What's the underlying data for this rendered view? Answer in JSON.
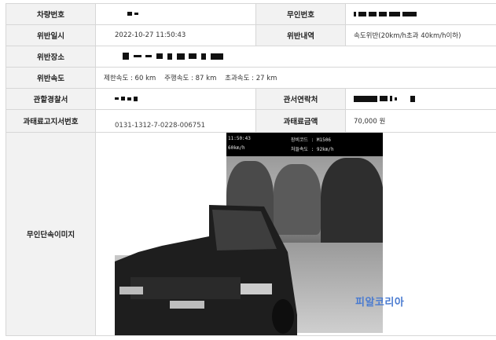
{
  "labels": {
    "vehicle_no": "차량번호",
    "camera_no": "무인번호",
    "violation_datetime": "위반일시",
    "violation_detail": "위반내역",
    "violation_place": "위반장소",
    "violation_speed": "위반속도",
    "police_station": "관할경찰서",
    "station_contact": "관서연락처",
    "fine_notice_no": "과태료고지서번호",
    "fine_amount": "과태료금액",
    "camera_image": "무인단속이미지"
  },
  "values": {
    "violation_datetime": "2022-10-27 11:50:43",
    "violation_detail": "속도위반(20km/h초과 40km/h이하)",
    "violation_speed": "제한속도 : 60 km    주행속도 : 87 km    초과속도 : 27 km",
    "fine_notice_no": "0131-1312-7-0228-006751",
    "fine_amount": "70,000 원"
  },
  "photo": {
    "time": "11:50:43",
    "speed_limit": "60km/h",
    "camera_code": "장비코드 : M1506",
    "detect_speed": "처들속도 : 92km/h",
    "watermark": "피알코리아"
  }
}
